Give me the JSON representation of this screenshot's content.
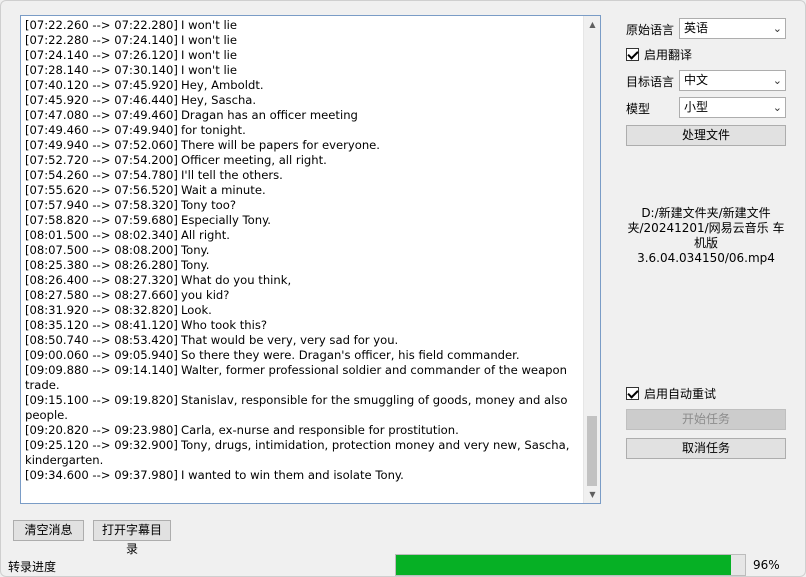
{
  "log": {
    "lines": [
      {
        "ts": "[07:22.260 --> 07:22.280]",
        "text": "I won't lie"
      },
      {
        "ts": "[07:22.280 --> 07:24.140]",
        "text": "I won't lie"
      },
      {
        "ts": "[07:24.140 --> 07:26.120]",
        "text": "I won't lie"
      },
      {
        "ts": "[07:28.140 --> 07:30.140]",
        "text": "I won't lie"
      },
      {
        "ts": "[07:40.120 --> 07:45.920]",
        "text": "Hey, Amboldt."
      },
      {
        "ts": "[07:45.920 --> 07:46.440]",
        "text": "Hey, Sascha."
      },
      {
        "ts": "[07:47.080 --> 07:49.460]",
        "text": "Dragan has an officer meeting"
      },
      {
        "ts": "[07:49.460 --> 07:49.940]",
        "text": "for tonight."
      },
      {
        "ts": "[07:49.940 --> 07:52.060]",
        "text": "There will be papers for everyone."
      },
      {
        "ts": "[07:52.720 --> 07:54.200]",
        "text": "Officer meeting, all right."
      },
      {
        "ts": "[07:54.260 --> 07:54.780]",
        "text": "I'll tell the others."
      },
      {
        "ts": "[07:55.620 --> 07:56.520]",
        "text": "Wait a minute."
      },
      {
        "ts": "[07:57.940 --> 07:58.320]",
        "text": "Tony too?"
      },
      {
        "ts": "[07:58.820 --> 07:59.680]",
        "text": "Especially Tony."
      },
      {
        "ts": "[08:01.500 --> 08:02.340]",
        "text": "All right."
      },
      {
        "ts": "[08:07.500 --> 08:08.200]",
        "text": "Tony."
      },
      {
        "ts": "[08:25.380 --> 08:26.280]",
        "text": "Tony."
      },
      {
        "ts": "[08:26.400 --> 08:27.320]",
        "text": "What do you think,"
      },
      {
        "ts": "[08:27.580 --> 08:27.660]",
        "text": "you kid?"
      },
      {
        "ts": "[08:31.920 --> 08:32.820]",
        "text": "Look."
      },
      {
        "ts": "[08:35.120 --> 08:41.120]",
        "text": "Who took this?"
      },
      {
        "ts": "[08:50.740 --> 08:53.420]",
        "text": "That would be very, very sad for you."
      },
      {
        "ts": "[09:00.060 --> 09:05.940]",
        "text": "So there they were. Dragan's officer, his field commander."
      },
      {
        "ts": "[09:09.880 --> 09:14.140]",
        "text": "Walter, former professional soldier and commander of the weapon trade."
      },
      {
        "ts": "[09:15.100 --> 09:19.820]",
        "text": "Stanislav, responsible for the smuggling of goods, money and also people."
      },
      {
        "ts": "[09:20.820 --> 09:23.980]",
        "text": "Carla, ex-nurse and responsible for prostitution."
      },
      {
        "ts": "[09:25.120 --> 09:32.900]",
        "text": "Tony, drugs, intimidation, protection money and very new, Sascha, kindergarten."
      },
      {
        "ts": "[09:34.600 --> 09:37.980]",
        "text": "I wanted to win them and isolate Tony."
      }
    ]
  },
  "settings": {
    "source_lang_label": "原始语言",
    "source_lang_value": "英语",
    "enable_translate_label": "启用翻译",
    "target_lang_label": "目标语言",
    "target_lang_value": "中文",
    "model_label": "模型",
    "model_value": "小型",
    "process_file_button": "处理文件",
    "file_path": "D:/新建文件夹/新建文件夹/20241201/网易云音乐 车机版 3.6.04.034150/06.mp4",
    "auto_retry_label": "启用自动重试",
    "start_task_button": "开始任务",
    "cancel_task_button": "取消任务"
  },
  "bottom": {
    "clear_button": "清空消息",
    "open_dir_button": "打开字幕目录",
    "status_label": "转录进度",
    "progress_percent": 96,
    "progress_text": "96%"
  }
}
